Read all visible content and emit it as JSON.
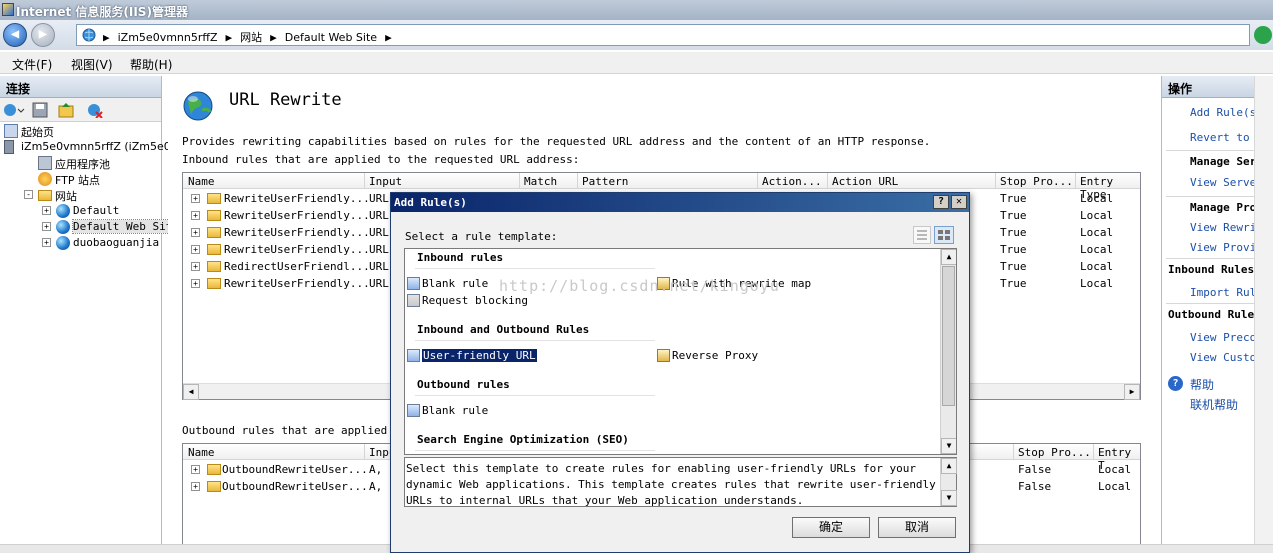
{
  "window": {
    "title": "Internet 信息服务(IIS)管理器"
  },
  "address": {
    "crumbs": [
      "iZm5e0vmnn5rffZ",
      "网站",
      "Default Web Site"
    ]
  },
  "menu": [
    "文件(F)",
    "视图(V)",
    "帮助(H)"
  ],
  "left": {
    "header": "连接",
    "tree": [
      {
        "label": "起始页",
        "icon": "start-page-icon",
        "indent": 0,
        "expander": ""
      },
      {
        "label": "iZm5e0vmnn5rffZ (iZm5e0v",
        "icon": "server-icon",
        "indent": 0,
        "expander": ""
      },
      {
        "label": "应用程序池",
        "icon": "app-pool-icon",
        "indent": 1,
        "expander": ""
      },
      {
        "label": "FTP 站点",
        "icon": "ftp-icon",
        "indent": 1,
        "expander": ""
      },
      {
        "label": "网站",
        "icon": "sites-folder-icon",
        "indent": 1,
        "expander": "-"
      },
      {
        "label": "Default",
        "icon": "globe-icon",
        "indent": 2,
        "expander": "+"
      },
      {
        "label": "Default Web Site",
        "icon": "globe-icon",
        "indent": 2,
        "expander": "+",
        "selected": true
      },
      {
        "label": "duobaoguanjia",
        "icon": "globe-icon",
        "indent": 2,
        "expander": "+"
      }
    ]
  },
  "center": {
    "title": "URL Rewrite",
    "description": "Provides rewriting capabilities based on rules for the requested URL address and the content of an HTTP response.",
    "inbound_caption": "Inbound rules that are applied to the requested URL address:",
    "inbound_columns": [
      "Name",
      "Input",
      "Match",
      "Pattern",
      "Action...",
      "Action URL",
      "Stop Pro...",
      "Entry Type"
    ],
    "inbound_rows": [
      {
        "name": "RewriteUserFriendly...",
        "input": "URL",
        "stop": "True",
        "entry": "Local"
      },
      {
        "name": "RewriteUserFriendly...",
        "input": "URL",
        "stop": "True",
        "entry": "Local"
      },
      {
        "name": "RewriteUserFriendly...",
        "input": "URL",
        "stop": "True",
        "entry": "Local"
      },
      {
        "name": "RewriteUserFriendly...",
        "input": "URL",
        "stop": "True",
        "entry": "Local"
      },
      {
        "name": "RedirectUserFriendl...",
        "input": "URL",
        "stop": "True",
        "entry": "Local"
      },
      {
        "name": "RewriteUserFriendly...",
        "input": "URL",
        "stop": "True",
        "entry": "Local"
      }
    ],
    "outbound_caption": "Outbound rules that are applied to",
    "outbound_columns": [
      "Name",
      "Inpu",
      "Stop Pro...",
      "Entry T"
    ],
    "outbound_rows": [
      {
        "name": "OutboundRewriteUser...",
        "input": "A, 1",
        "stop": "False",
        "entry": "Local"
      },
      {
        "name": "OutboundRewriteUser...",
        "input": "A, 1",
        "stop": "False",
        "entry": "Local"
      }
    ]
  },
  "actions": {
    "header": "操作",
    "items": [
      {
        "text": "Add Rule(s)",
        "kind": "link",
        "icon": "add-icon"
      },
      {
        "text": "Revert to P",
        "kind": "link",
        "icon": ""
      },
      {
        "text": "Manage Ser",
        "kind": "bold",
        "icon": ""
      },
      {
        "text": "View Server",
        "kind": "link",
        "icon": ""
      },
      {
        "text": "Manage Pro",
        "kind": "bold",
        "icon": ""
      },
      {
        "text": "View Rewrit",
        "kind": "link",
        "icon": ""
      },
      {
        "text": "View Provid",
        "kind": "link",
        "icon": ""
      },
      {
        "text": "Inbound Rules",
        "kind": "section",
        "icon": ""
      },
      {
        "text": "Import Rule",
        "kind": "link",
        "icon": ""
      },
      {
        "text": "Outbound Rule",
        "kind": "section",
        "icon": ""
      },
      {
        "text": "View Precon",
        "kind": "link",
        "icon": ""
      },
      {
        "text": "View Custom",
        "kind": "link",
        "icon": ""
      },
      {
        "text": "帮助",
        "kind": "link",
        "icon": "help-icon"
      },
      {
        "text": "联机帮助",
        "kind": "link",
        "icon": ""
      }
    ]
  },
  "dialog": {
    "title": "Add Rule(s)",
    "prompt": "Select a rule template:",
    "sections": [
      {
        "header": "Inbound rules",
        "items": [
          {
            "label": "Blank rule",
            "col": 0,
            "row": 0
          },
          {
            "label": "Rule with rewrite map",
            "col": 1,
            "row": 0
          },
          {
            "label": "Request blocking",
            "col": 0,
            "row": 1
          }
        ]
      },
      {
        "header": "Inbound and Outbound Rules",
        "items": [
          {
            "label": "User-friendly URL",
            "col": 0,
            "row": 0,
            "selected": true
          },
          {
            "label": "Reverse Proxy",
            "col": 1,
            "row": 0
          }
        ]
      },
      {
        "header": "Outbound rules",
        "items": [
          {
            "label": "Blank rule",
            "col": 0,
            "row": 0
          }
        ]
      },
      {
        "header": "Search Engine Optimization (SEO)",
        "items": []
      }
    ],
    "description": "Select this template to create rules for enabling user-friendly URLs for your dynamic Web applications. This template creates rules that rewrite user-friendly URLs to internal URLs that your Web application understands.",
    "ok": "确定",
    "cancel": "取消",
    "watermark": "http://blog.csdn.net/kingoyu"
  }
}
